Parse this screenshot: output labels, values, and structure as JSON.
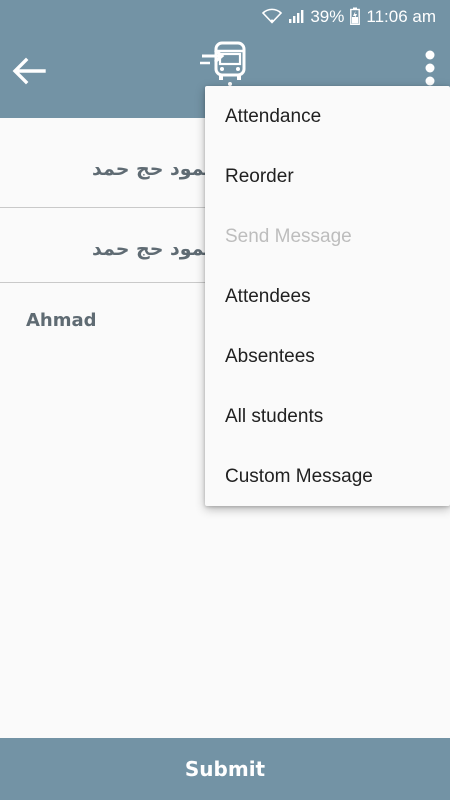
{
  "status_bar": {
    "battery": "39%",
    "time": "11:06 am"
  },
  "app_bar": {
    "back_icon": "arrow-left-icon",
    "logo_icon": "bus-icon",
    "overflow_icon": "more-vertical-icon"
  },
  "students": [
    {
      "name": "محمود حج حمد"
    },
    {
      "name": "محمود حج حمد"
    },
    {
      "name": "Ahmad"
    }
  ],
  "menu": {
    "items": [
      {
        "label": "Attendance",
        "enabled": true
      },
      {
        "label": "Reorder",
        "enabled": true
      },
      {
        "label": "Send Message",
        "enabled": false
      },
      {
        "label": "Attendees",
        "enabled": true
      },
      {
        "label": "Absentees",
        "enabled": true
      },
      {
        "label": "All students",
        "enabled": true
      },
      {
        "label": "Custom Message",
        "enabled": true
      }
    ]
  },
  "submit": {
    "label": "Submit"
  },
  "colors": {
    "primary": "#7393a5",
    "background": "#fafafa",
    "list_text": "#5f6b73",
    "disabled_text": "#bdbdbd"
  }
}
